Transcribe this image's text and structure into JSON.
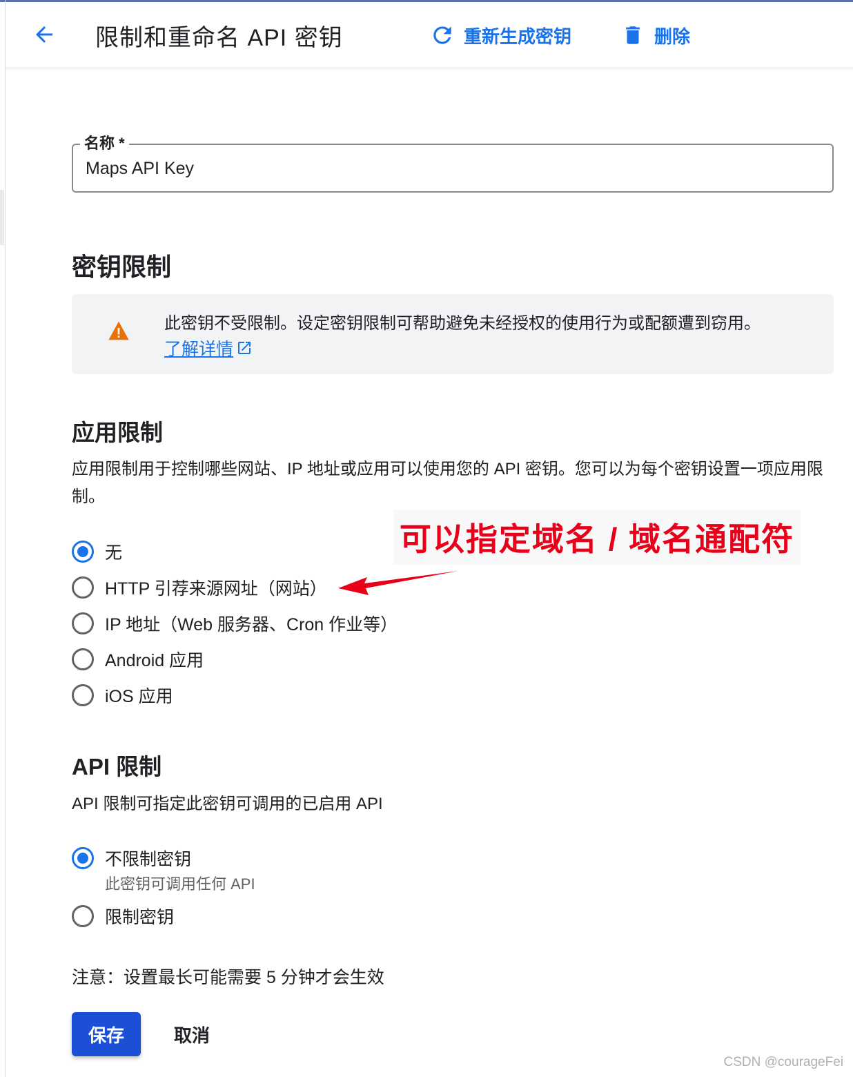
{
  "header": {
    "title": "限制和重命名 API 密钥",
    "regenerate_label": "重新生成密钥",
    "delete_label": "删除"
  },
  "name_field": {
    "label": "名称 *",
    "value": "Maps API Key"
  },
  "key_restrictions": {
    "heading": "密钥限制",
    "warning_text": "此密钥不受限制。设定密钥限制可帮助避免未经授权的使用行为或配额遭到窃用。",
    "learn_more_label": "了解详情"
  },
  "app_restrictions": {
    "heading": "应用限制",
    "description": "应用限制用于控制哪些网站、IP 地址或应用可以使用您的 API 密钥。您可以为每个密钥设置一项应用限制。",
    "options": [
      {
        "label": "无",
        "selected": true
      },
      {
        "label": "HTTP 引荐来源网址（网站）",
        "selected": false
      },
      {
        "label": "IP 地址（Web 服务器、Cron 作业等）",
        "selected": false
      },
      {
        "label": "Android 应用",
        "selected": false
      },
      {
        "label": "iOS 应用",
        "selected": false
      }
    ]
  },
  "annotation": {
    "text": "可以指定域名 / 域名通配符",
    "color": "#e8001a"
  },
  "api_restrictions": {
    "heading": "API 限制",
    "description": "API 限制可指定此密钥可调用的已启用 API",
    "options": [
      {
        "label": "不限制密钥",
        "sublabel": "此密钥可调用任何 API",
        "selected": true
      },
      {
        "label": "限制密钥",
        "selected": false
      }
    ]
  },
  "note": "注意：设置最长可能需要 5 分钟才会生效",
  "actions": {
    "save_label": "保存",
    "cancel_label": "取消"
  },
  "watermark": "CSDN @courageFei",
  "colors": {
    "accent": "#1a73e8",
    "primary_button": "#1a4fd6",
    "warning": "#e8710a"
  },
  "icons": {
    "back": "arrow-back-icon",
    "regenerate": "refresh-icon",
    "delete": "trash-icon",
    "warning": "warning-icon",
    "external": "open-in-new-icon"
  }
}
